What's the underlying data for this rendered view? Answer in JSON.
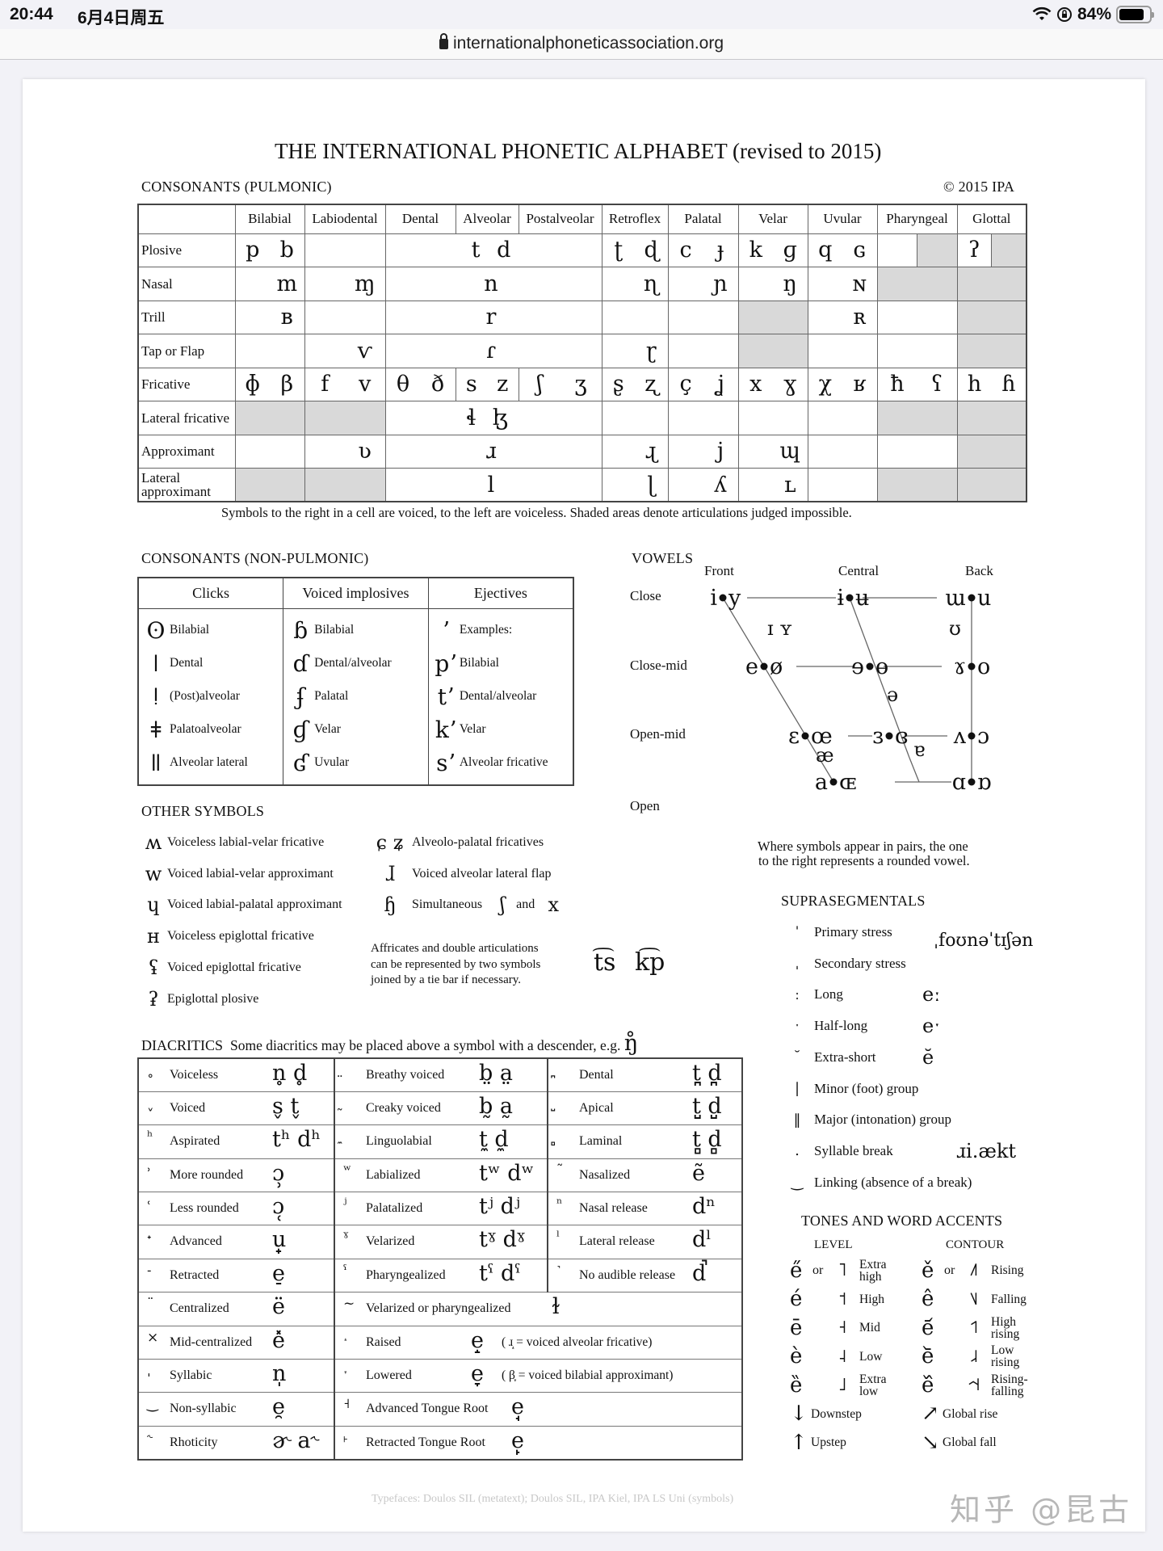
{
  "status_bar": {
    "time": "20:44",
    "date": "6月4日周五",
    "battery": "84%",
    "battery_level": 0.84,
    "icons": [
      "wifi-icon",
      "orientation-lock-icon",
      "battery-icon"
    ]
  },
  "browser": {
    "url": "internationalphoneticassociation.org",
    "lock_icon": "lock-icon"
  },
  "chart": {
    "title": "THE INTERNATIONAL PHONETIC ALPHABET (revised to 2015)",
    "copyright": "© 2015 IPA",
    "pulmonic": {
      "heading": "CONSONANTS (PULMONIC)",
      "columns": [
        "Bilabial",
        "Labiodental",
        "Dental",
        "Alveolar",
        "Postalveolar",
        "Retroflex",
        "Palatal",
        "Velar",
        "Uvular",
        "Pharyngeal",
        "Glottal"
      ],
      "rows": [
        {
          "label": "Plosive",
          "cells": [
            "p b",
            "",
            "",
            "t d",
            "",
            "ʈ ɖ",
            "c ɟ",
            "k ɡ",
            "q ɢ",
            "",
            "ʔ"
          ]
        },
        {
          "label": "Nasal",
          "cells": [
            "m",
            "ɱ",
            "",
            "n",
            "",
            "ɳ",
            "ɲ",
            "ŋ",
            "ɴ",
            "",
            ""
          ]
        },
        {
          "label": "Trill",
          "cells": [
            "ʙ",
            "",
            "",
            "r",
            "",
            "",
            "",
            "",
            "ʀ",
            "",
            ""
          ]
        },
        {
          "label": "Tap or Flap",
          "cells": [
            "",
            "ⱱ",
            "",
            "ɾ",
            "",
            "ɽ",
            "",
            "",
            "",
            "",
            ""
          ]
        },
        {
          "label": "Fricative",
          "cells": [
            "ɸ β",
            "f v",
            "θ ð",
            "s z",
            "ʃ ʒ",
            "ʂ ʐ",
            "ç ʝ",
            "x ɣ",
            "χ ʁ",
            "ħ ʕ",
            "h ɦ"
          ]
        },
        {
          "label": "Lateral fricative",
          "cells": [
            "",
            "",
            "",
            "ɬ ɮ",
            "",
            "",
            "",
            "",
            "",
            "",
            ""
          ]
        },
        {
          "label": "Approximant",
          "cells": [
            "",
            "ʋ",
            "",
            "ɹ",
            "",
            "ɻ",
            "j",
            "ɰ",
            "",
            "",
            ""
          ]
        },
        {
          "label": "Lateral approximant",
          "cells": [
            "",
            "",
            "",
            "l",
            "",
            "ɭ",
            "ʎ",
            "ʟ",
            "",
            "",
            ""
          ]
        }
      ],
      "note": "Symbols to the right in a cell are voiced, to the left are voiceless. Shaded areas denote articulations judged impossible."
    },
    "non_pulmonic": {
      "heading": "CONSONANTS (NON-PULMONIC)",
      "columns": [
        "Clicks",
        "Voiced implosives",
        "Ejectives"
      ],
      "clicks": [
        {
          "sym": "ʘ",
          "label": "Bilabial"
        },
        {
          "sym": "ǀ",
          "label": "Dental"
        },
        {
          "sym": "ǃ",
          "label": "(Post)alveolar"
        },
        {
          "sym": "ǂ",
          "label": "Palatoalveolar"
        },
        {
          "sym": "ǁ",
          "label": "Alveolar lateral"
        }
      ],
      "implosives": [
        {
          "sym": "ɓ",
          "label": "Bilabial"
        },
        {
          "sym": "ɗ",
          "label": "Dental/alveolar"
        },
        {
          "sym": "ʄ",
          "label": "Palatal"
        },
        {
          "sym": "ɠ",
          "label": "Velar"
        },
        {
          "sym": "ʛ",
          "label": "Uvular"
        }
      ],
      "ejectives": [
        {
          "sym": "ʼ",
          "label": "Examples:"
        },
        {
          "sym": "pʼ",
          "label": "Bilabial"
        },
        {
          "sym": "tʼ",
          "label": "Dental/alveolar"
        },
        {
          "sym": "kʼ",
          "label": "Velar"
        },
        {
          "sym": "sʼ",
          "label": "Alveolar fricative"
        }
      ]
    },
    "vowels": {
      "heading": "VOWELS",
      "columns": [
        "Front",
        "Central",
        "Back"
      ],
      "rows": [
        "Close",
        "Close-mid",
        "Open-mid",
        "Open"
      ],
      "pairs": {
        "close_front": [
          "i",
          "y"
        ],
        "close_central": [
          "ɨ",
          "ʉ"
        ],
        "close_back": [
          "ɯ",
          "u"
        ],
        "closemid_front": [
          "e",
          "ø"
        ],
        "closemid_central": [
          "ɘ",
          "ɵ"
        ],
        "closemid_back": [
          "ɤ",
          "o"
        ],
        "openmid_front": [
          "ɛ",
          "œ"
        ],
        "openmid_central": [
          "ɜ",
          "ɞ"
        ],
        "openmid_back": [
          "ʌ",
          "ɔ"
        ],
        "open_front": [
          "a",
          "ɶ"
        ],
        "open_back": [
          "ɑ",
          "ɒ"
        ]
      },
      "singles": {
        "near_close_front": "ɪ ʏ",
        "near_close_back": "ʊ",
        "schwa": "ə",
        "near_open_front": "æ",
        "near_open_central": "ɐ"
      },
      "note_line1": "Where symbols appear in pairs, the one",
      "note_line2": "to the right represents a rounded vowel."
    },
    "other_symbols": {
      "heading": "OTHER SYMBOLS",
      "left": [
        {
          "sym": "ʍ",
          "label": "Voiceless labial-velar fricative"
        },
        {
          "sym": "w",
          "label": "Voiced labial-velar approximant"
        },
        {
          "sym": "ɥ",
          "label": "Voiced labial-palatal approximant"
        },
        {
          "sym": "ʜ",
          "label": "Voiceless epiglottal fricative"
        },
        {
          "sym": "ʢ",
          "label": "Voiced epiglottal fricative"
        },
        {
          "sym": "ʡ",
          "label": "Epiglottal plosive"
        }
      ],
      "right": [
        {
          "sym": "ɕ ʑ",
          "label": "Alveolo-palatal fricatives"
        },
        {
          "sym": "ɺ",
          "label": "Voiced alveolar lateral flap"
        },
        {
          "sym": "ɧ",
          "label": "Simultaneous",
          "sym2": "ʃ",
          "and": "and",
          "sym3": "x"
        }
      ],
      "affricate_note": [
        "Affricates and double articulations",
        "can be represented by two symbols",
        "joined by a tie bar if necessary."
      ],
      "affricate_examples": [
        "t͡s",
        "k͡p"
      ]
    },
    "diacritics": {
      "heading": "DIACRITICS",
      "subheading": "Some diacritics may be placed above a symbol with a descender, e.g.",
      "example": "ŋ̊",
      "rows": [
        [
          {
            "m": "˳",
            "l": "Voiceless",
            "e": "n̥  d̥"
          },
          {
            "m": "̤",
            "l": "Breathy voiced",
            "e": "b̤  a̤"
          },
          {
            "m": "̪",
            "l": "Dental",
            "e": "t̪  d̪"
          }
        ],
        [
          {
            "m": "ˬ",
            "l": "Voiced",
            "e": "s̬  t̬"
          },
          {
            "m": "̰",
            "l": "Creaky voiced",
            "e": "b̰  a̰"
          },
          {
            "m": "̺",
            "l": "Apical",
            "e": "t̺  d̺"
          }
        ],
        [
          {
            "m": "ʰ",
            "l": "Aspirated",
            "e": "tʰ dʰ"
          },
          {
            "m": "̼",
            "l": "Linguolabial",
            "e": "t̼  d̼"
          },
          {
            "m": "̻",
            "l": "Laminal",
            "e": "t̻  d̻"
          }
        ],
        [
          {
            "m": "˒",
            "l": "More rounded",
            "e": "ɔ̹"
          },
          {
            "m": "ʷ",
            "l": "Labialized",
            "e": "tʷ  dʷ"
          },
          {
            "m": "˜",
            "l": "Nasalized",
            "e": "ẽ"
          }
        ],
        [
          {
            "m": "˓",
            "l": "Less rounded",
            "e": "ɔ̜"
          },
          {
            "m": "ʲ",
            "l": "Palatalized",
            "e": "tʲ  dʲ"
          },
          {
            "m": "ⁿ",
            "l": "Nasal release",
            "e": "dⁿ"
          }
        ],
        [
          {
            "m": "˖",
            "l": "Advanced",
            "e": "u̟"
          },
          {
            "m": "ˠ",
            "l": "Velarized",
            "e": "tˠ  dˠ"
          },
          {
            "m": "ˡ",
            "l": "Lateral release",
            "e": "dˡ"
          }
        ],
        [
          {
            "m": "˗",
            "l": "Retracted",
            "e": "e̠"
          },
          {
            "m": "ˤ",
            "l": "Pharyngealized",
            "e": "tˤ  dˤ"
          },
          {
            "m": "˺",
            "l": "No audible release",
            "e": "d̚"
          }
        ]
      ],
      "wide_rows": [
        {
          "left": {
            "m": "¨",
            "l": "Centralized",
            "e": "ë"
          },
          "right": {
            "m": "~",
            "l": "Velarized or pharyngealized",
            "e": "ɫ"
          }
        },
        {
          "left": {
            "m": "×",
            "l": "Mid-centralized",
            "e": "e̽"
          },
          "right": {
            "m": "˔",
            "l": "Raised",
            "e": "e̝",
            "note": "( ɹ̝ = voiced alveolar fricative)"
          }
        },
        {
          "left": {
            "m": "ˌ",
            "l": "Syllabic",
            "e": "n̩"
          },
          "right": {
            "m": "˕",
            "l": "Lowered",
            "e": "e̞",
            "note": "( β̞ = voiced bilabial approximant)"
          }
        },
        {
          "left": {
            "m": "‿",
            "l": "Non-syllabic",
            "e": "e̯"
          },
          "right": {
            "m": "˧",
            "l": "Advanced Tongue Root",
            "e": "e̘"
          }
        },
        {
          "left": {
            "m": "˞",
            "l": "Rhoticity",
            "e": "ɚ  a˞"
          },
          "right": {
            "m": "˫",
            "l": "Retracted Tongue Root",
            "e": "e̙"
          }
        }
      ]
    },
    "suprasegmentals": {
      "heading": "SUPRASEGMENTALS",
      "items": [
        {
          "m": "ˈ",
          "l": "Primary stress"
        },
        {
          "m": "ˌ",
          "l": "Secondary stress"
        },
        {
          "m": "ː",
          "l": "Long",
          "e": "eː"
        },
        {
          "m": "ˑ",
          "l": "Half-long",
          "e": "eˑ"
        },
        {
          "m": "˘",
          "l": "Extra-short",
          "e": "ĕ"
        },
        {
          "m": "|",
          "l": "Minor (foot) group"
        },
        {
          "m": "‖",
          "l": "Major (intonation) group"
        },
        {
          "m": ".",
          "l": "Syllable break",
          "e": "ɹi.ækt"
        },
        {
          "m": "‿",
          "l": "Linking (absence of a break)"
        }
      ],
      "stress_example": "ˌfoʊnəˈtɪʃən"
    },
    "tones": {
      "heading": "TONES AND WORD ACCENTS",
      "level_heading": "LEVEL",
      "contour_heading": "CONTOUR",
      "or": "or",
      "level": [
        {
          "s": "e̋",
          "g": "˥",
          "l": "Extra high"
        },
        {
          "s": "é",
          "g": "˦",
          "l": "High"
        },
        {
          "s": "ē",
          "g": "˧",
          "l": "Mid"
        },
        {
          "s": "è",
          "g": "˨",
          "l": "Low"
        },
        {
          "s": "ȅ",
          "g": "˩",
          "l": "Extra low"
        },
        {
          "s": "↓",
          "g": "",
          "l": "Downstep"
        },
        {
          "s": "↑",
          "g": "",
          "l": "Upstep"
        }
      ],
      "contour": [
        {
          "s": "ě",
          "g": "˩˥",
          "l": "Rising"
        },
        {
          "s": "ê",
          "g": "˥˩",
          "l": "Falling"
        },
        {
          "s": "e᷄",
          "g": "˦˥",
          "l": "High rising"
        },
        {
          "s": "e᷅",
          "g": "˩˨",
          "l": "Low rising"
        },
        {
          "s": "e᷈",
          "g": "˧˦˧",
          "l": "Rising-falling"
        },
        {
          "s": "↗",
          "g": "",
          "l": "Global rise"
        },
        {
          "s": "↘",
          "g": "",
          "l": "Global fall"
        }
      ]
    },
    "footer": "Typefaces: Doulos SIL (metatext); Doulos SIL, IPA Kiel, IPA LS Uni (symbols)"
  },
  "watermark": "知乎 @昆古"
}
